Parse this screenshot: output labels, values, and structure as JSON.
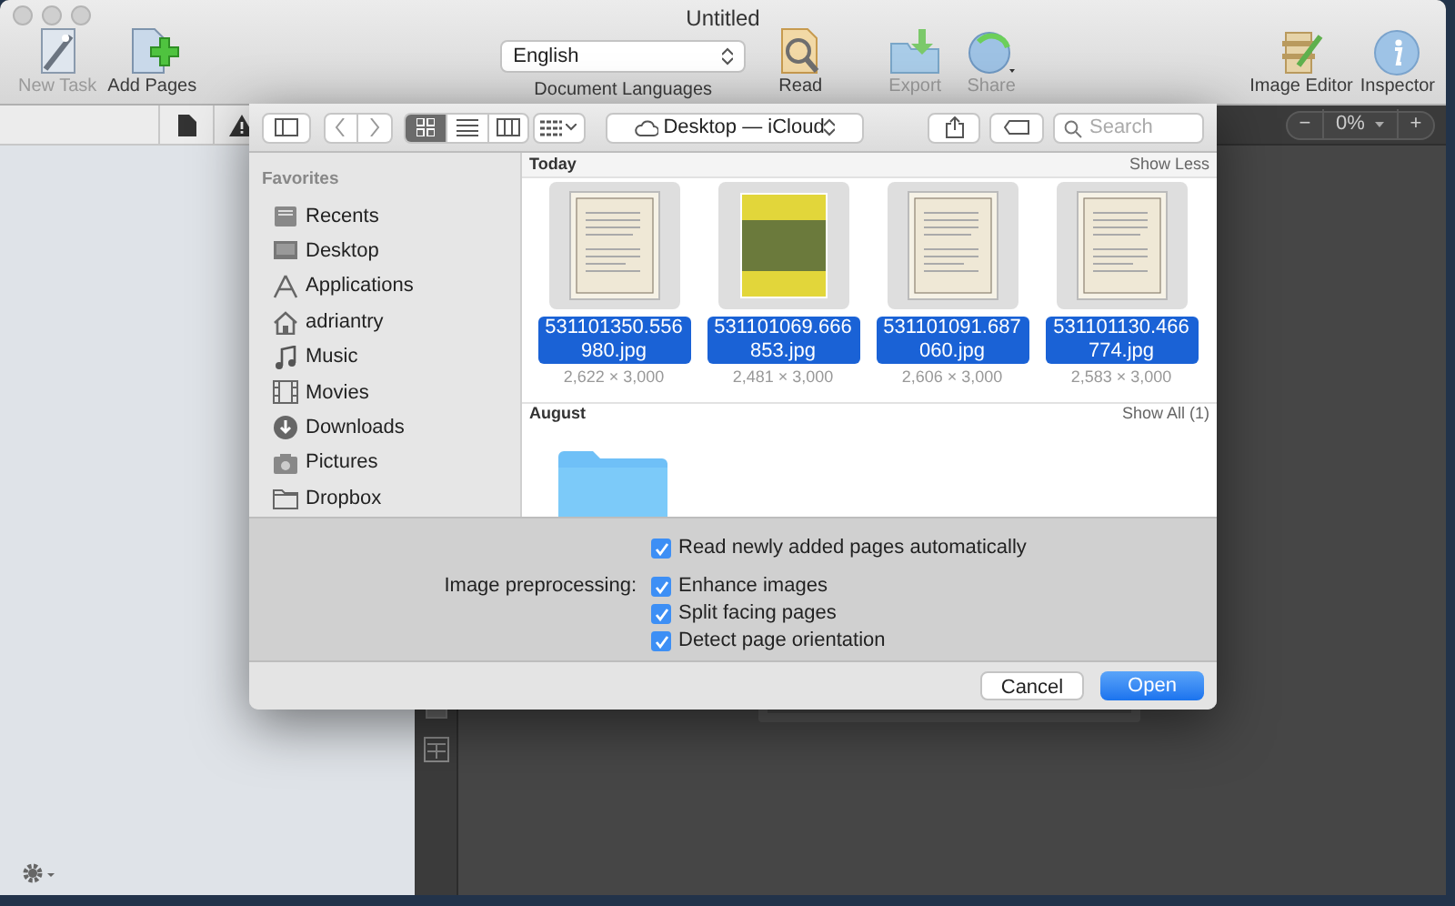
{
  "window": {
    "title": "Untitled"
  },
  "toolbar": {
    "left": [
      {
        "label": "New Task",
        "disabled": true
      },
      {
        "label": "Add Pages",
        "disabled": false
      }
    ],
    "language": {
      "value": "English",
      "label": "Document Languages"
    },
    "center": [
      {
        "label": "Read",
        "disabled": false
      },
      {
        "label": "Export",
        "disabled": true
      },
      {
        "label": "Share",
        "disabled": true
      }
    ],
    "right": [
      {
        "label": "Image Editor",
        "disabled": false
      },
      {
        "label": "Inspector",
        "disabled": false
      }
    ]
  },
  "zoom": {
    "minus": "−",
    "value": "0%",
    "plus": "+"
  },
  "dialog": {
    "view_modes": [
      {
        "selected": true
      },
      {
        "selected": false
      },
      {
        "selected": false
      }
    ],
    "location": "Desktop — iCloud",
    "search": {
      "placeholder": "Search"
    },
    "sidebar": {
      "heading": "Favorites",
      "items": [
        {
          "label": "Recents"
        },
        {
          "label": "Desktop"
        },
        {
          "label": "Applications"
        },
        {
          "label": "adriantry"
        },
        {
          "label": "Music"
        },
        {
          "label": "Movies"
        },
        {
          "label": "Downloads"
        },
        {
          "label": "Pictures"
        },
        {
          "label": "Dropbox"
        }
      ]
    },
    "sections": [
      {
        "title": "Today",
        "action": "Show Less",
        "items": [
          {
            "kind": "document",
            "name": "531101350.556980.jpg",
            "size": "2,622 × 3,000",
            "selected": true
          },
          {
            "kind": "photo",
            "name": "531101069.666853.jpg",
            "size": "2,481 × 3,000",
            "selected": true
          },
          {
            "kind": "document",
            "name": "531101091.687060.jpg",
            "size": "2,606 × 3,000",
            "selected": true
          },
          {
            "kind": "document",
            "name": "531101130.466774.jpg",
            "size": "2,583 × 3,000",
            "selected": true
          }
        ]
      },
      {
        "title": "August",
        "action": "Show All (1)",
        "items": [
          {
            "kind": "folder"
          }
        ]
      }
    ],
    "options": {
      "auto_read": {
        "label": "Read newly added pages automatically",
        "checked": true
      },
      "preprocessing": {
        "label": "Image preprocessing:",
        "options": [
          {
            "label": "Enhance images",
            "checked": true
          },
          {
            "label": "Split facing pages",
            "checked": true
          },
          {
            "label": "Detect page orientation",
            "checked": true
          }
        ]
      }
    },
    "buttons": [
      {
        "label": "Cancel",
        "default": false
      },
      {
        "label": "Open",
        "default": true
      }
    ]
  }
}
